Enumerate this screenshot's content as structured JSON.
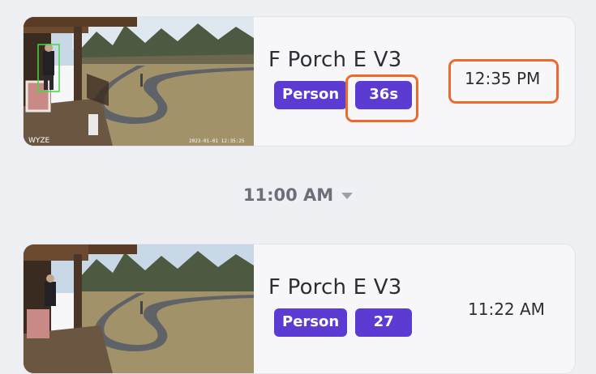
{
  "events": [
    {
      "camera_name": "F Porch E V3",
      "tags": [
        "Person",
        "36s"
      ],
      "time": "12:35 PM",
      "thumbnail_watermark": "WYZE",
      "thumbnail_timestamp": "2023-01-01 12:35:25"
    },
    {
      "camera_name": "F Porch E V3",
      "tags": [
        "Person",
        "27"
      ],
      "time": "11:22 AM"
    }
  ],
  "time_group": {
    "label": "11:00 AM",
    "icon": "caret-down-icon"
  },
  "colors": {
    "tag_background": "#5b3bd2",
    "highlight": "#ed6a2c",
    "card_background": "#f7f7f9",
    "page_background": "#eff0f3"
  }
}
